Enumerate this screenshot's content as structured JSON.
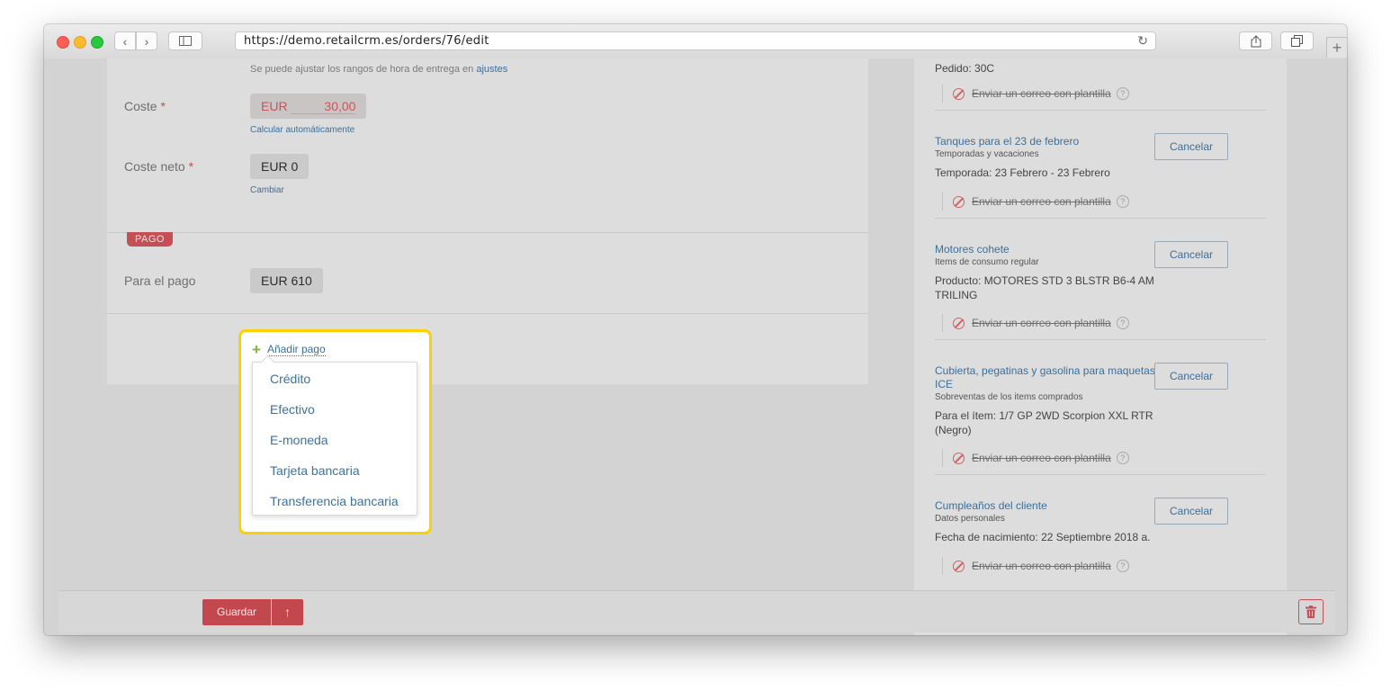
{
  "browser": {
    "url": "https://demo.retailcrm.es/orders/76/edit"
  },
  "delivery": {
    "time_hint": "Se puede ajustar los rangos de hora de entrega en",
    "time_hint_link": "ajustes",
    "cost_label": "Coste",
    "required_mark": "*",
    "cost_currency": "EUR",
    "cost_value": "30,00",
    "calc_auto": "Calcular automáticamente",
    "net_cost_label": "Coste neto",
    "net_cost_value": "EUR 0",
    "change_link": "Cambiar"
  },
  "payment": {
    "section_tag": "PAGO",
    "to_pay_label": "Para el pago",
    "to_pay_value": "EUR 610",
    "add_payment": "Añadir pago",
    "options": [
      "Crédito",
      "Efectivo",
      "E-moneda",
      "Tarjeta bancaria",
      "Transferencia bancaria"
    ]
  },
  "tasks": {
    "cancel_label": "Cancelar",
    "email_label": "Enviar un correo con plantilla",
    "top_partial": "Pedido: 30C",
    "items": [
      {
        "title": "Tanques para el 23 de febrero",
        "category": "Temporadas y vacaciones",
        "description": "Temporada: 23 Febrero - 23 Febrero"
      },
      {
        "title": "Motores cohete",
        "category": "Items de consumo regular",
        "description": "Producto: MOTORES STD 3 BLSTR B6-4 AM TRILING"
      },
      {
        "title": "Cubierta, pegatinas y gasolina para maquetas ICE",
        "category": "Sobreventas de los items comprados",
        "description": "Para el ítem: 1/7 GP 2WD Scorpion XXL RTR (Negro)"
      },
      {
        "title": "Cumpleaños del cliente",
        "category": "Datos personales",
        "description": "Fecha de nacimiento: 22 Septiembre 2018 a."
      }
    ]
  },
  "footer": {
    "save_label": "Guardar",
    "save_extra_icon": "arrow-up-icon",
    "delete_icon": "trash-icon"
  },
  "colors": {
    "accent_red": "#c3484d",
    "highlight": "#fdd101",
    "link_blue": "#3b6f9a"
  }
}
